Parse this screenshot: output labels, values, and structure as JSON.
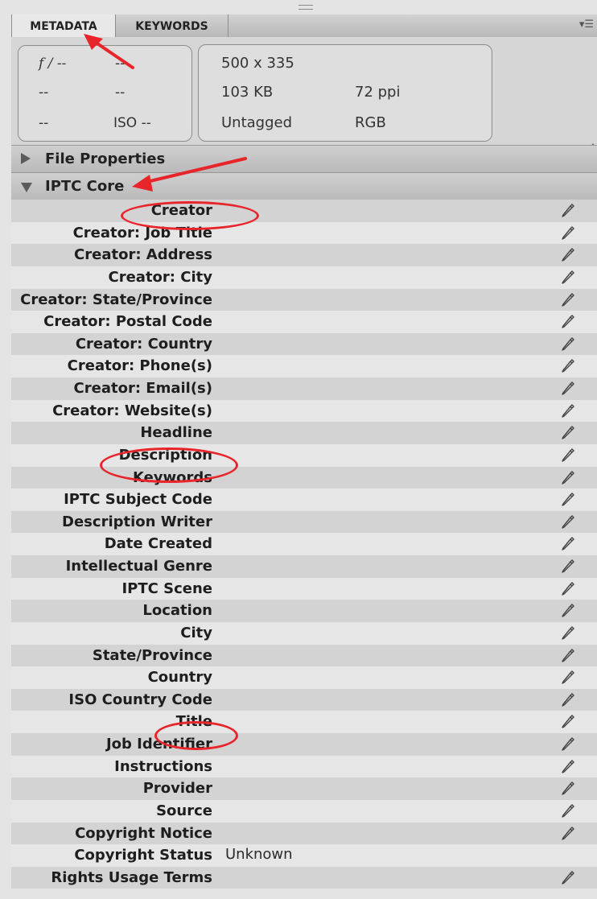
{
  "tabs": [
    {
      "label": "METADATA",
      "active": true
    },
    {
      "label": "KEYWORDS",
      "active": false
    }
  ],
  "panel_menu_icon": "panel-menu-icon",
  "camera_data": {
    "f_stop": "f / --",
    "shutter": "--",
    "metering": "--",
    "focal": "--",
    "exposure_bias": "--",
    "iso": "ISO --"
  },
  "file_info": {
    "dimensions": "500 x 335",
    "size": "103 KB",
    "resolution": "72 ppi",
    "color_profile": "Untagged",
    "color_mode": "RGB"
  },
  "sections": {
    "file_properties": "File Properties",
    "iptc_core": "IPTC Core"
  },
  "iptc_fields": [
    {
      "label": "Creator",
      "value": "",
      "editable": true
    },
    {
      "label": "Creator: Job Title",
      "value": "",
      "editable": true
    },
    {
      "label": "Creator: Address",
      "value": "",
      "editable": true
    },
    {
      "label": "Creator: City",
      "value": "",
      "editable": true
    },
    {
      "label": "Creator: State/Province",
      "value": "",
      "editable": true
    },
    {
      "label": "Creator: Postal Code",
      "value": "",
      "editable": true
    },
    {
      "label": "Creator: Country",
      "value": "",
      "editable": true
    },
    {
      "label": "Creator: Phone(s)",
      "value": "",
      "editable": true
    },
    {
      "label": "Creator: Email(s)",
      "value": "",
      "editable": true
    },
    {
      "label": "Creator: Website(s)",
      "value": "",
      "editable": true
    },
    {
      "label": "Headline",
      "value": "",
      "editable": true
    },
    {
      "label": "Description",
      "value": "",
      "editable": true
    },
    {
      "label": "Keywords",
      "value": "",
      "editable": true
    },
    {
      "label": "IPTC Subject Code",
      "value": "",
      "editable": true
    },
    {
      "label": "Description Writer",
      "value": "",
      "editable": true
    },
    {
      "label": "Date Created",
      "value": "",
      "editable": true
    },
    {
      "label": "Intellectual Genre",
      "value": "",
      "editable": true
    },
    {
      "label": "IPTC Scene",
      "value": "",
      "editable": true
    },
    {
      "label": "Location",
      "value": "",
      "editable": true
    },
    {
      "label": "City",
      "value": "",
      "editable": true
    },
    {
      "label": "State/Province",
      "value": "",
      "editable": true
    },
    {
      "label": "Country",
      "value": "",
      "editable": true
    },
    {
      "label": "ISO Country Code",
      "value": "",
      "editable": true
    },
    {
      "label": "Title",
      "value": "",
      "editable": true
    },
    {
      "label": "Job Identifier",
      "value": "",
      "editable": true
    },
    {
      "label": "Instructions",
      "value": "",
      "editable": true
    },
    {
      "label": "Provider",
      "value": "",
      "editable": true
    },
    {
      "label": "Source",
      "value": "",
      "editable": true
    },
    {
      "label": "Copyright Notice",
      "value": "",
      "editable": true
    },
    {
      "label": "Copyright Status",
      "value": "Unknown",
      "editable": false
    },
    {
      "label": "Rights Usage Terms",
      "value": "",
      "editable": true
    }
  ],
  "colors": {
    "annotation": "#e8252a",
    "row_alt": "#d3d3d3",
    "row_plain": "#e6e6e6"
  }
}
